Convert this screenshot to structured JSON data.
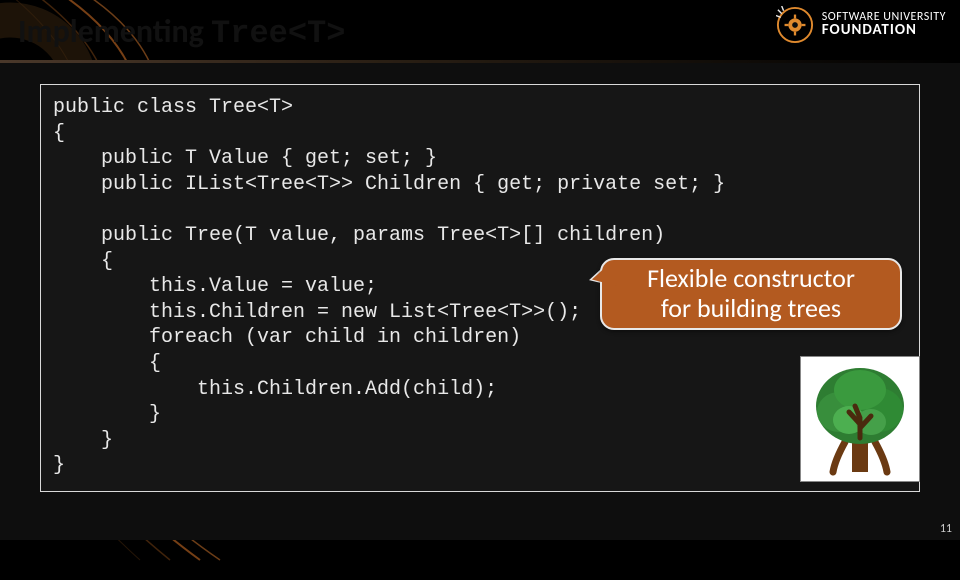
{
  "title_plain": "Implementing ",
  "title_mono": "Tree<T>",
  "logo": {
    "line1": "SOFTWARE UNIVERSITY",
    "line2": "FOUNDATION"
  },
  "code": "public class Tree<T>\n{\n    public T Value { get; set; }\n    public IList<Tree<T>> Children { get; private set; }\n\n    public Tree(T value, params Tree<T>[] children)\n    {\n        this.Value = value;\n        this.Children = new List<Tree<T>>();\n        foreach (var child in children)\n        {\n            this.Children.Add(child);\n        }\n    }\n}",
  "callout": "Flexible constructor\nfor building trees",
  "page_number": "11"
}
